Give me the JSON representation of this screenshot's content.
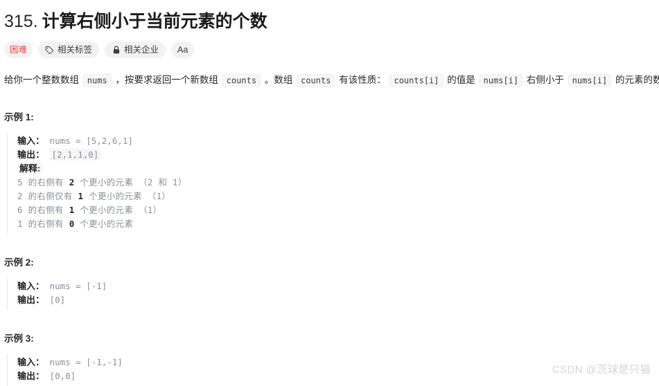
{
  "problem": {
    "number": "315.",
    "title": "计算右侧小于当前元素的个数"
  },
  "badges": [
    {
      "label": "困难",
      "icon": ""
    },
    {
      "label": "相关标签",
      "icon": "tag-icon"
    },
    {
      "label": "相关企业",
      "icon": "lock-icon"
    },
    {
      "label": "Aa",
      "icon": "font-size-icon"
    }
  ],
  "description": {
    "t1": "给你一个整数数组",
    "c1": "nums",
    "t2": "，按要求返回一个新数组",
    "c2": "counts",
    "t3": "。数组",
    "c3": "counts",
    "t4": "有该性质：",
    "c4": "counts[i]",
    "t5": "的值是",
    "c5": "nums[i]",
    "t6": "右侧小于",
    "c6": "nums[i]",
    "t7": "的元素的数量。"
  },
  "examples": [
    {
      "heading": "示例 1:",
      "input_label": "输入：",
      "input_value": "nums = [5,2,6,1]",
      "output_label": "输出：",
      "output_value": "[2,1,1,0]",
      "explain_label": "解释:",
      "explain_lines": [
        {
          "pre": "5 的右侧有 ",
          "num": "2",
          "post": " 个更小的元素 （2 和 1）"
        },
        {
          "pre": "2 的右侧仅有 ",
          "num": "1",
          "post": " 个更小的元素 （1）"
        },
        {
          "pre": "6 的右侧有 ",
          "num": "1",
          "post": " 个更小的元素 （1）"
        },
        {
          "pre": "1 的右侧有 ",
          "num": "0",
          "post": " 个更小的元素"
        }
      ]
    },
    {
      "heading": "示例 2:",
      "input_label": "输入：",
      "input_value": "nums = [-1]",
      "output_label": "输出：",
      "output_value": "[0]"
    },
    {
      "heading": "示例 3:",
      "input_label": "输入：",
      "input_value": "nums = [-1,-1]",
      "output_label": "输出：",
      "output_value": "[0,0]"
    }
  ],
  "watermark": "CSDN @茨球是只猫",
  "colors": {
    "difficulty": "#ef4743",
    "badge_bg": "#f2f2f2",
    "code_bg": "#f7f7f8",
    "muted_text": "#8a8f98",
    "watermark": "#d4d4d4"
  }
}
